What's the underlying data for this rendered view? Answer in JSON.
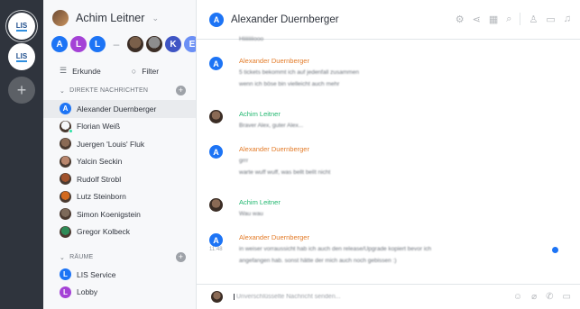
{
  "rail": {
    "workspaces": [
      {
        "label": "LIS"
      },
      {
        "label": "LIS"
      }
    ],
    "add_icon": "+"
  },
  "sidebar": {
    "user_name": "Achim Leitner",
    "strip": [
      {
        "type": "letter",
        "letter": "A",
        "color": "#1d74f5"
      },
      {
        "type": "letter",
        "letter": "L",
        "color": "#a442d6"
      },
      {
        "type": "letter",
        "letter": "L",
        "color": "#1d74f5"
      },
      {
        "type": "dash"
      },
      {
        "type": "photo",
        "color": "#7a5f4a"
      },
      {
        "type": "photo",
        "color": "#8d8d8d"
      },
      {
        "type": "letter",
        "letter": "K",
        "color": "#3f55c4"
      },
      {
        "type": "letter",
        "letter": "E",
        "color": "#6b8ff5"
      }
    ],
    "tools": {
      "home": "Erkunde",
      "filter": "Filter"
    },
    "dm_section": "DIREKTE NACHRICHTEN",
    "dms": [
      {
        "name": "Alexander Duernberger",
        "letter": "A",
        "color": "#1d74f5",
        "status": "#f5455c",
        "active": true
      },
      {
        "name": "Florian Weiß",
        "letter": "",
        "color": "#f7f8fa",
        "status": "#2de0a5",
        "active": false
      },
      {
        "name": "Juergen 'Louis' Fluk",
        "letter": "",
        "color": "#8a6a55",
        "status": "",
        "active": false
      },
      {
        "name": "Yalcin Seckin",
        "letter": "",
        "color": "#b9866d",
        "status": "",
        "active": false
      },
      {
        "name": "Rudolf Strobl",
        "letter": "",
        "color": "#a0522d",
        "status": "",
        "active": false
      },
      {
        "name": "Lutz Steinborn",
        "letter": "",
        "color": "#d2691e",
        "status": "",
        "active": false
      },
      {
        "name": "Simon Koenigstein",
        "letter": "",
        "color": "#7d6a5a",
        "status": "",
        "active": false
      },
      {
        "name": "Gregor Kolbeck",
        "letter": "",
        "color": "#2e8b57",
        "status": "",
        "active": false
      }
    ],
    "rooms_section": "RÄUME",
    "rooms": [
      {
        "name": "LIS Service",
        "letter": "L",
        "color": "#1d74f5"
      },
      {
        "name": "Lobby",
        "letter": "L",
        "color": "#a442d6"
      }
    ]
  },
  "header": {
    "title": "Alexander Duernberger",
    "avatar_letter": "A"
  },
  "messages": [
    {
      "author": "",
      "lines": [
        "Hiiiiiiiiooo"
      ],
      "avatar": "none"
    },
    {
      "author": "Alexander Duernberger",
      "author_color": "orange",
      "lines": [
        "5 tickets bekommt ich auf jedenfall zusammen",
        "wenn ich böse bin vielleicht auch mehr"
      ],
      "avatar": "blue",
      "letter": "A"
    },
    {
      "author": "Achim Leitner",
      "author_color": "green",
      "lines": [
        "Braver Alex, guter Alex..."
      ],
      "avatar": "photo"
    },
    {
      "author": "Alexander Duernberger",
      "author_color": "orange",
      "lines": [
        "grrr",
        "warte wuff wuff, was bellt bellt nicht"
      ],
      "avatar": "blue",
      "letter": "A"
    },
    {
      "author": "Achim Leitner",
      "author_color": "green",
      "lines": [
        "Wau wau"
      ],
      "avatar": "photo"
    },
    {
      "author": "Alexander Duernberger",
      "author_color": "orange",
      "time": "11:48",
      "lines": [
        "in weiser vorraussicht hab ich auch den release/Upgrade kopiert bevor ich",
        "angefangen hab. sonst hätte der mich auch noch gebissen :)"
      ],
      "avatar": "blue",
      "letter": "A"
    }
  ],
  "composer": {
    "placeholder": "Unverschlüsselte Nachricht senden..."
  }
}
